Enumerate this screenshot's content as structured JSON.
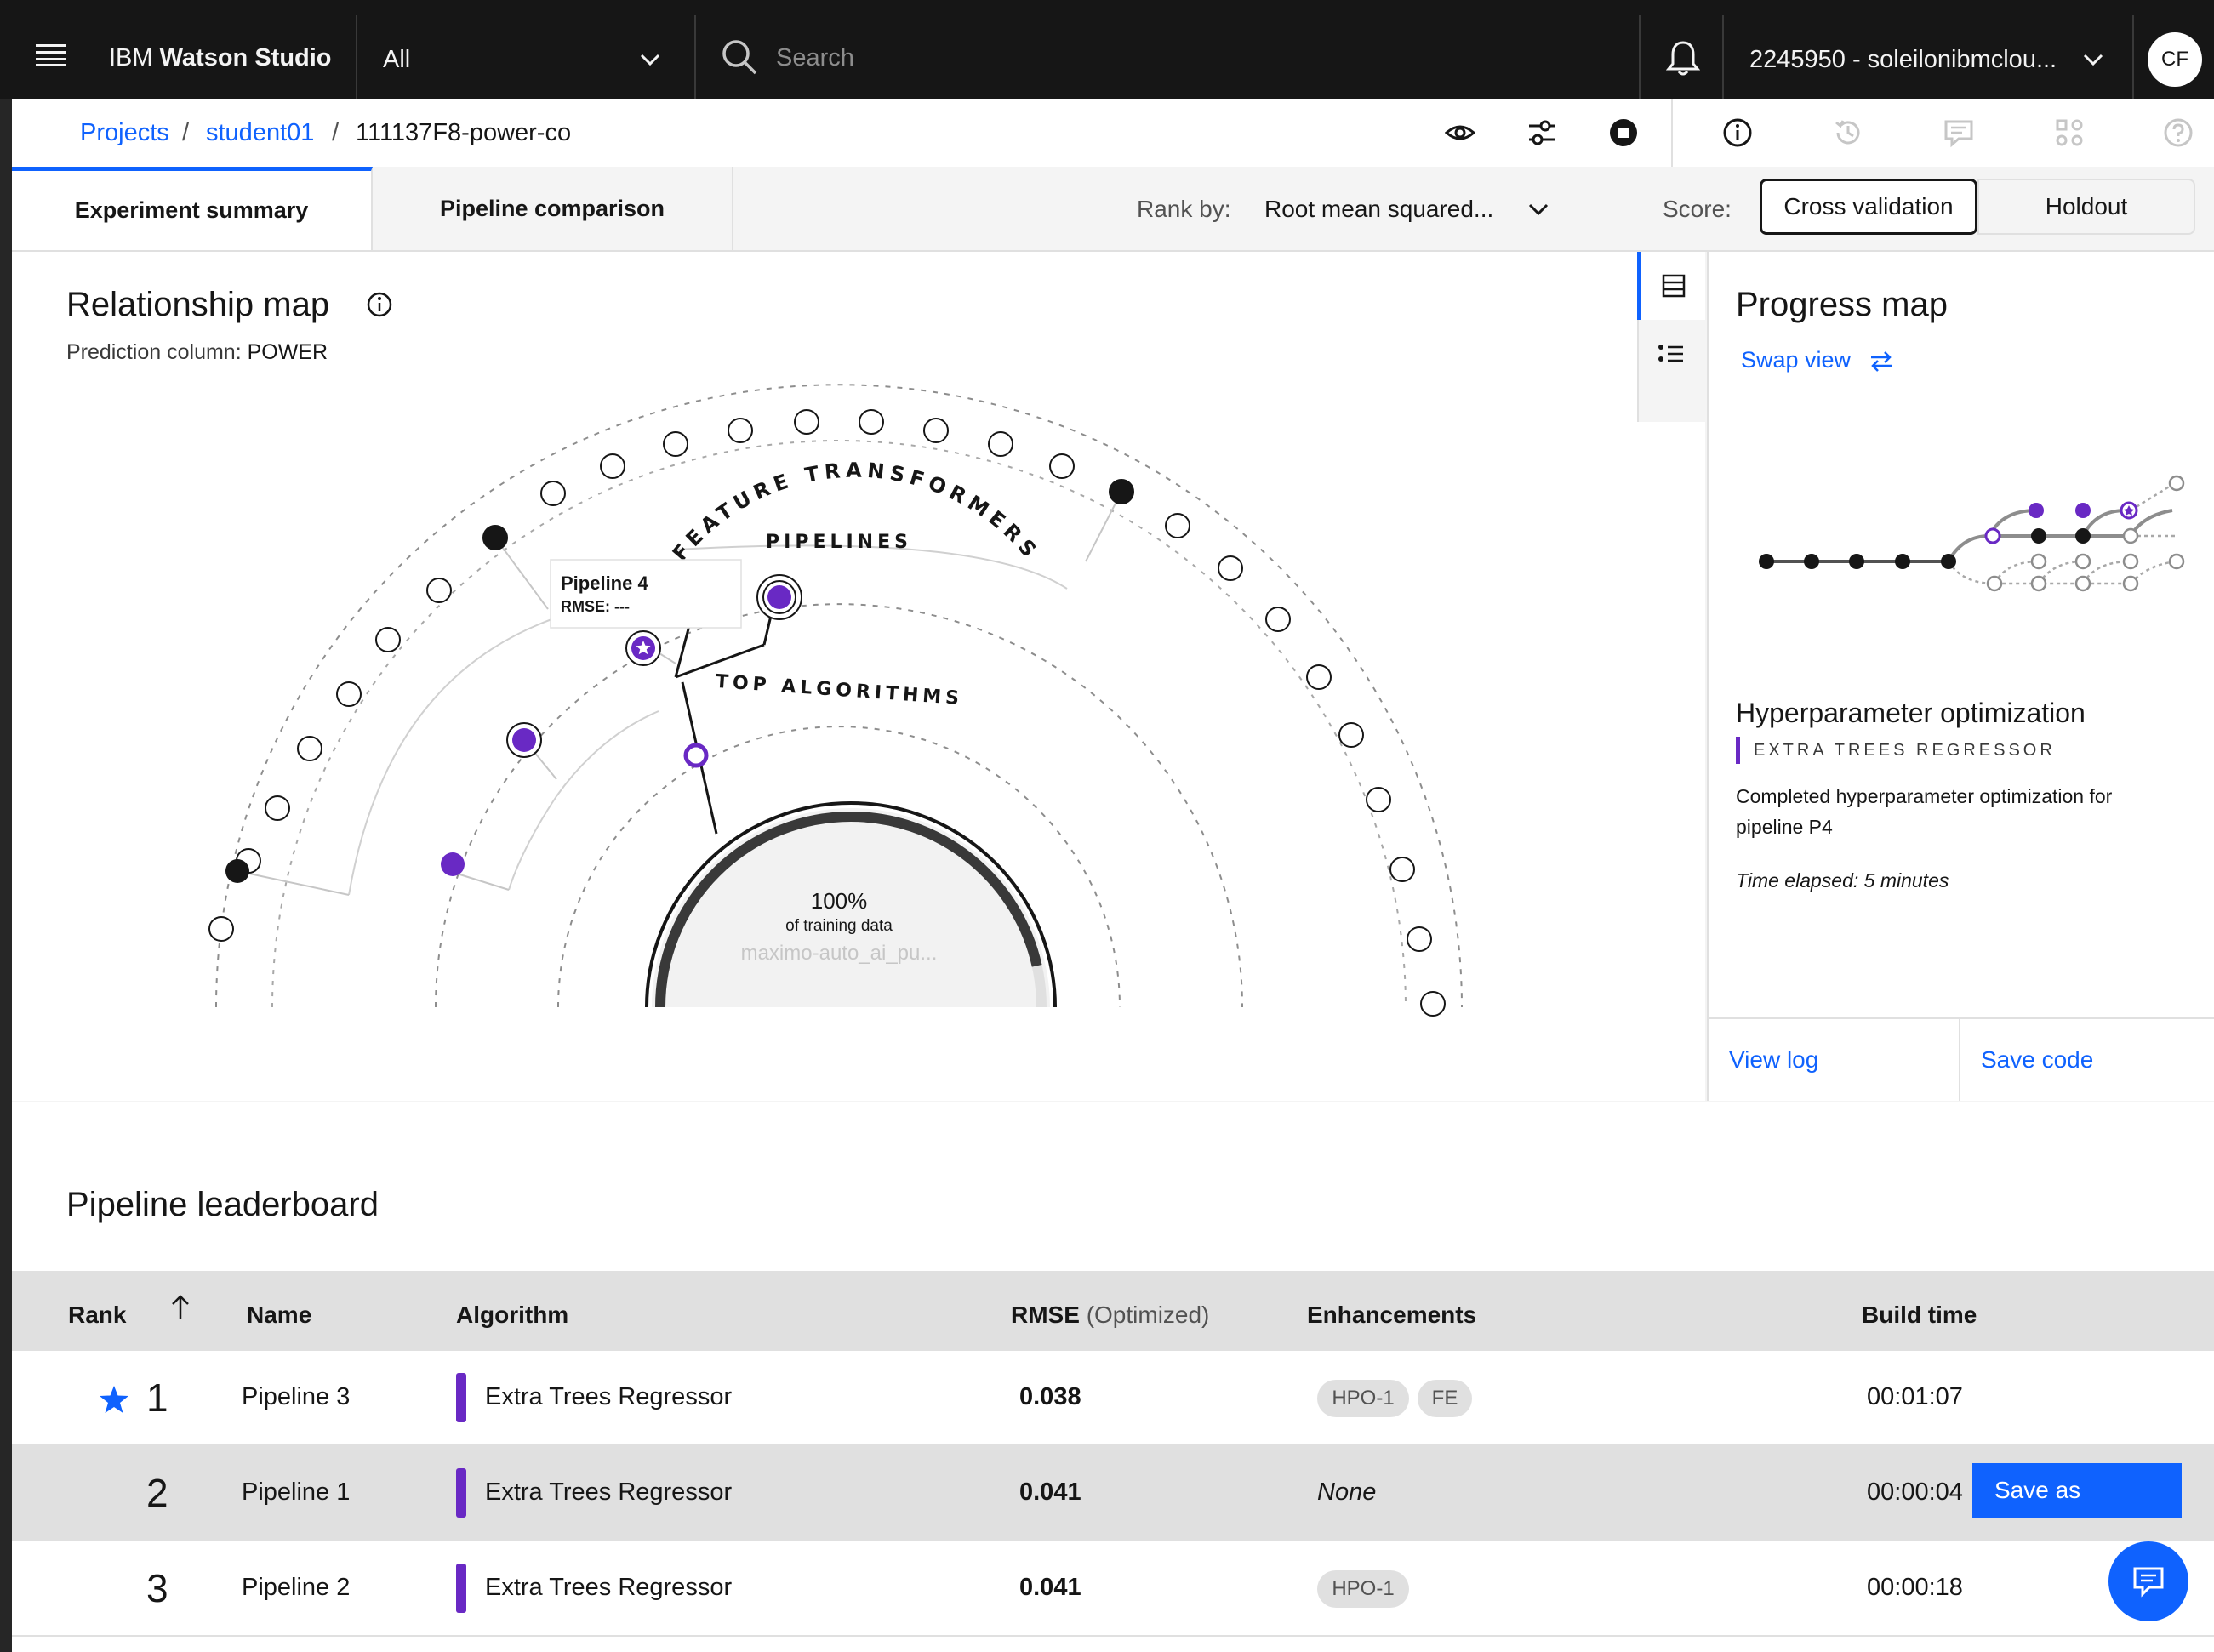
{
  "header": {
    "app_name_prefix": "IBM",
    "app_name": "Watson Studio",
    "scope_select": "All",
    "search_placeholder": "Search",
    "account": "2245950 - soleilonibmclou...",
    "avatar": "CF"
  },
  "breadcrumb": {
    "items": [
      "Projects",
      "student01",
      "111137F8-power-co"
    ],
    "separator": "/"
  },
  "tabs": [
    {
      "label": "Experiment summary",
      "selected": true
    },
    {
      "label": "Pipeline comparison",
      "selected": false
    }
  ],
  "rank_by": {
    "label": "Rank by:",
    "value": "Root mean squared..."
  },
  "score": {
    "label": "Score:",
    "options": [
      "Cross validation",
      "Holdout"
    ],
    "selected": "Cross validation"
  },
  "relationship_map": {
    "title": "Relationship map",
    "prediction_label": "Prediction column:",
    "prediction_value": "POWER",
    "ring_labels": [
      "FEATURE TRANSFORMERS",
      "PIPELINES",
      "TOP ALGORITHMS"
    ],
    "center_percent": "100%",
    "center_caption": "of training data",
    "center_source": "maximo-auto_ai_pu...",
    "training_fraction": 1.0,
    "tooltip_title": "Pipeline 4",
    "tooltip_metric": "RMSE: ---"
  },
  "progress_map": {
    "title": "Progress map",
    "swap_view": "Swap view",
    "stage_title": "Hyperparameter optimization",
    "stage_algorithm": "EXTRA TREES REGRESSOR",
    "description": "Completed hyperparameter optimization for pipeline P4",
    "time_elapsed": "Time elapsed: 5 minutes",
    "view_log": "View log",
    "save_code": "Save code"
  },
  "leaderboard": {
    "title": "Pipeline leaderboard",
    "columns": {
      "rank": "Rank",
      "name": "Name",
      "algorithm": "Algorithm",
      "metric": "RMSE",
      "metric_note": "(Optimized)",
      "enhancements": "Enhancements",
      "build_time": "Build time"
    },
    "rows": [
      {
        "rank": "1",
        "name": "Pipeline 3",
        "algorithm": "Extra Trees Regressor",
        "rmse": "0.038",
        "enhancements": [
          "HPO-1",
          "FE"
        ],
        "build_time": "00:01:07"
      },
      {
        "rank": "2",
        "name": "Pipeline 1",
        "algorithm": "Extra Trees Regressor",
        "rmse": "0.041",
        "enhancements_text": "None",
        "build_time": "00:00:04"
      },
      {
        "rank": "3",
        "name": "Pipeline 2",
        "algorithm": "Extra Trees Regressor",
        "rmse": "0.041",
        "enhancements": [
          "HPO-1"
        ],
        "build_time": "00:00:18"
      }
    ],
    "save_as": "Save as"
  },
  "colors": {
    "accent": "#0f62fe",
    "purple": "#6929c4",
    "header_bg": "#161616"
  }
}
